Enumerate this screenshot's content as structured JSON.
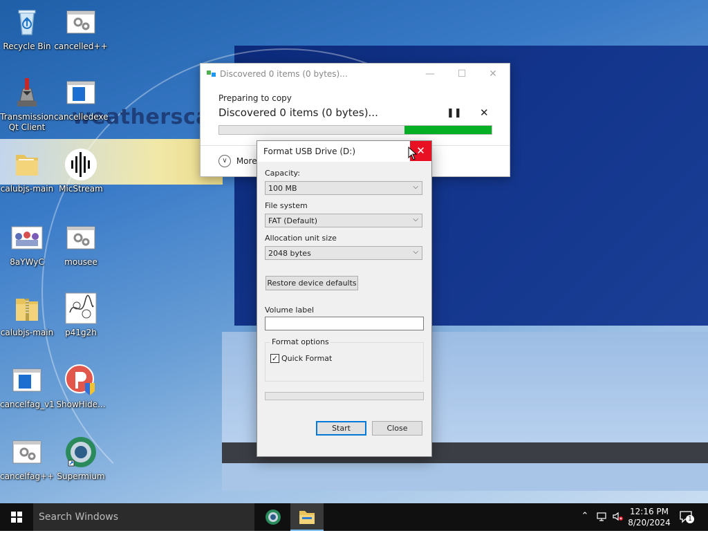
{
  "desktop": {
    "background_text": "weathersca",
    "icons": [
      {
        "label": "Recycle Bin"
      },
      {
        "label": "cancelled++"
      },
      {
        "label": "Transmission Qt Client"
      },
      {
        "label": "cancelledexe"
      },
      {
        "label": "calubjs-main"
      },
      {
        "label": "MicStream"
      },
      {
        "label": "8aYWyC"
      },
      {
        "label": "mousee"
      },
      {
        "label": "calubjs-main"
      },
      {
        "label": "p41g2h"
      },
      {
        "label": "cancelfag_v1"
      },
      {
        "label": "ShowHide..."
      },
      {
        "label": "cancelfag++"
      },
      {
        "label": "Supermium"
      }
    ]
  },
  "copy_dialog": {
    "title": "Discovered 0 items (0 bytes)...",
    "subtitle": "Preparing to copy",
    "main_text": "Discovered 0 items (0 bytes)...",
    "pause_glyph": "❚❚",
    "stop_glyph": "✕",
    "progress": 0.32,
    "more_label": "More",
    "progress_color": "#06b025"
  },
  "format_dialog": {
    "title": "Format USB Drive (D:)",
    "close_glyph": "✕",
    "capacity_label": "Capacity:",
    "capacity_value": "100 MB",
    "filesystem_label": "File system",
    "filesystem_value": "FAT (Default)",
    "allocation_label": "Allocation unit size",
    "allocation_value": "2048 bytes",
    "restore_button": "Restore device defaults",
    "volume_label": "Volume label",
    "volume_value": "",
    "format_options_label": "Format options",
    "quick_format_label": "Quick Format",
    "quick_format_checked": "✓",
    "start_button": "Start",
    "close_button": "Close"
  },
  "taskbar": {
    "search_placeholder": "Search Windows",
    "time": "12:16 PM",
    "date": "8/20/2024",
    "notification_count": "1"
  }
}
